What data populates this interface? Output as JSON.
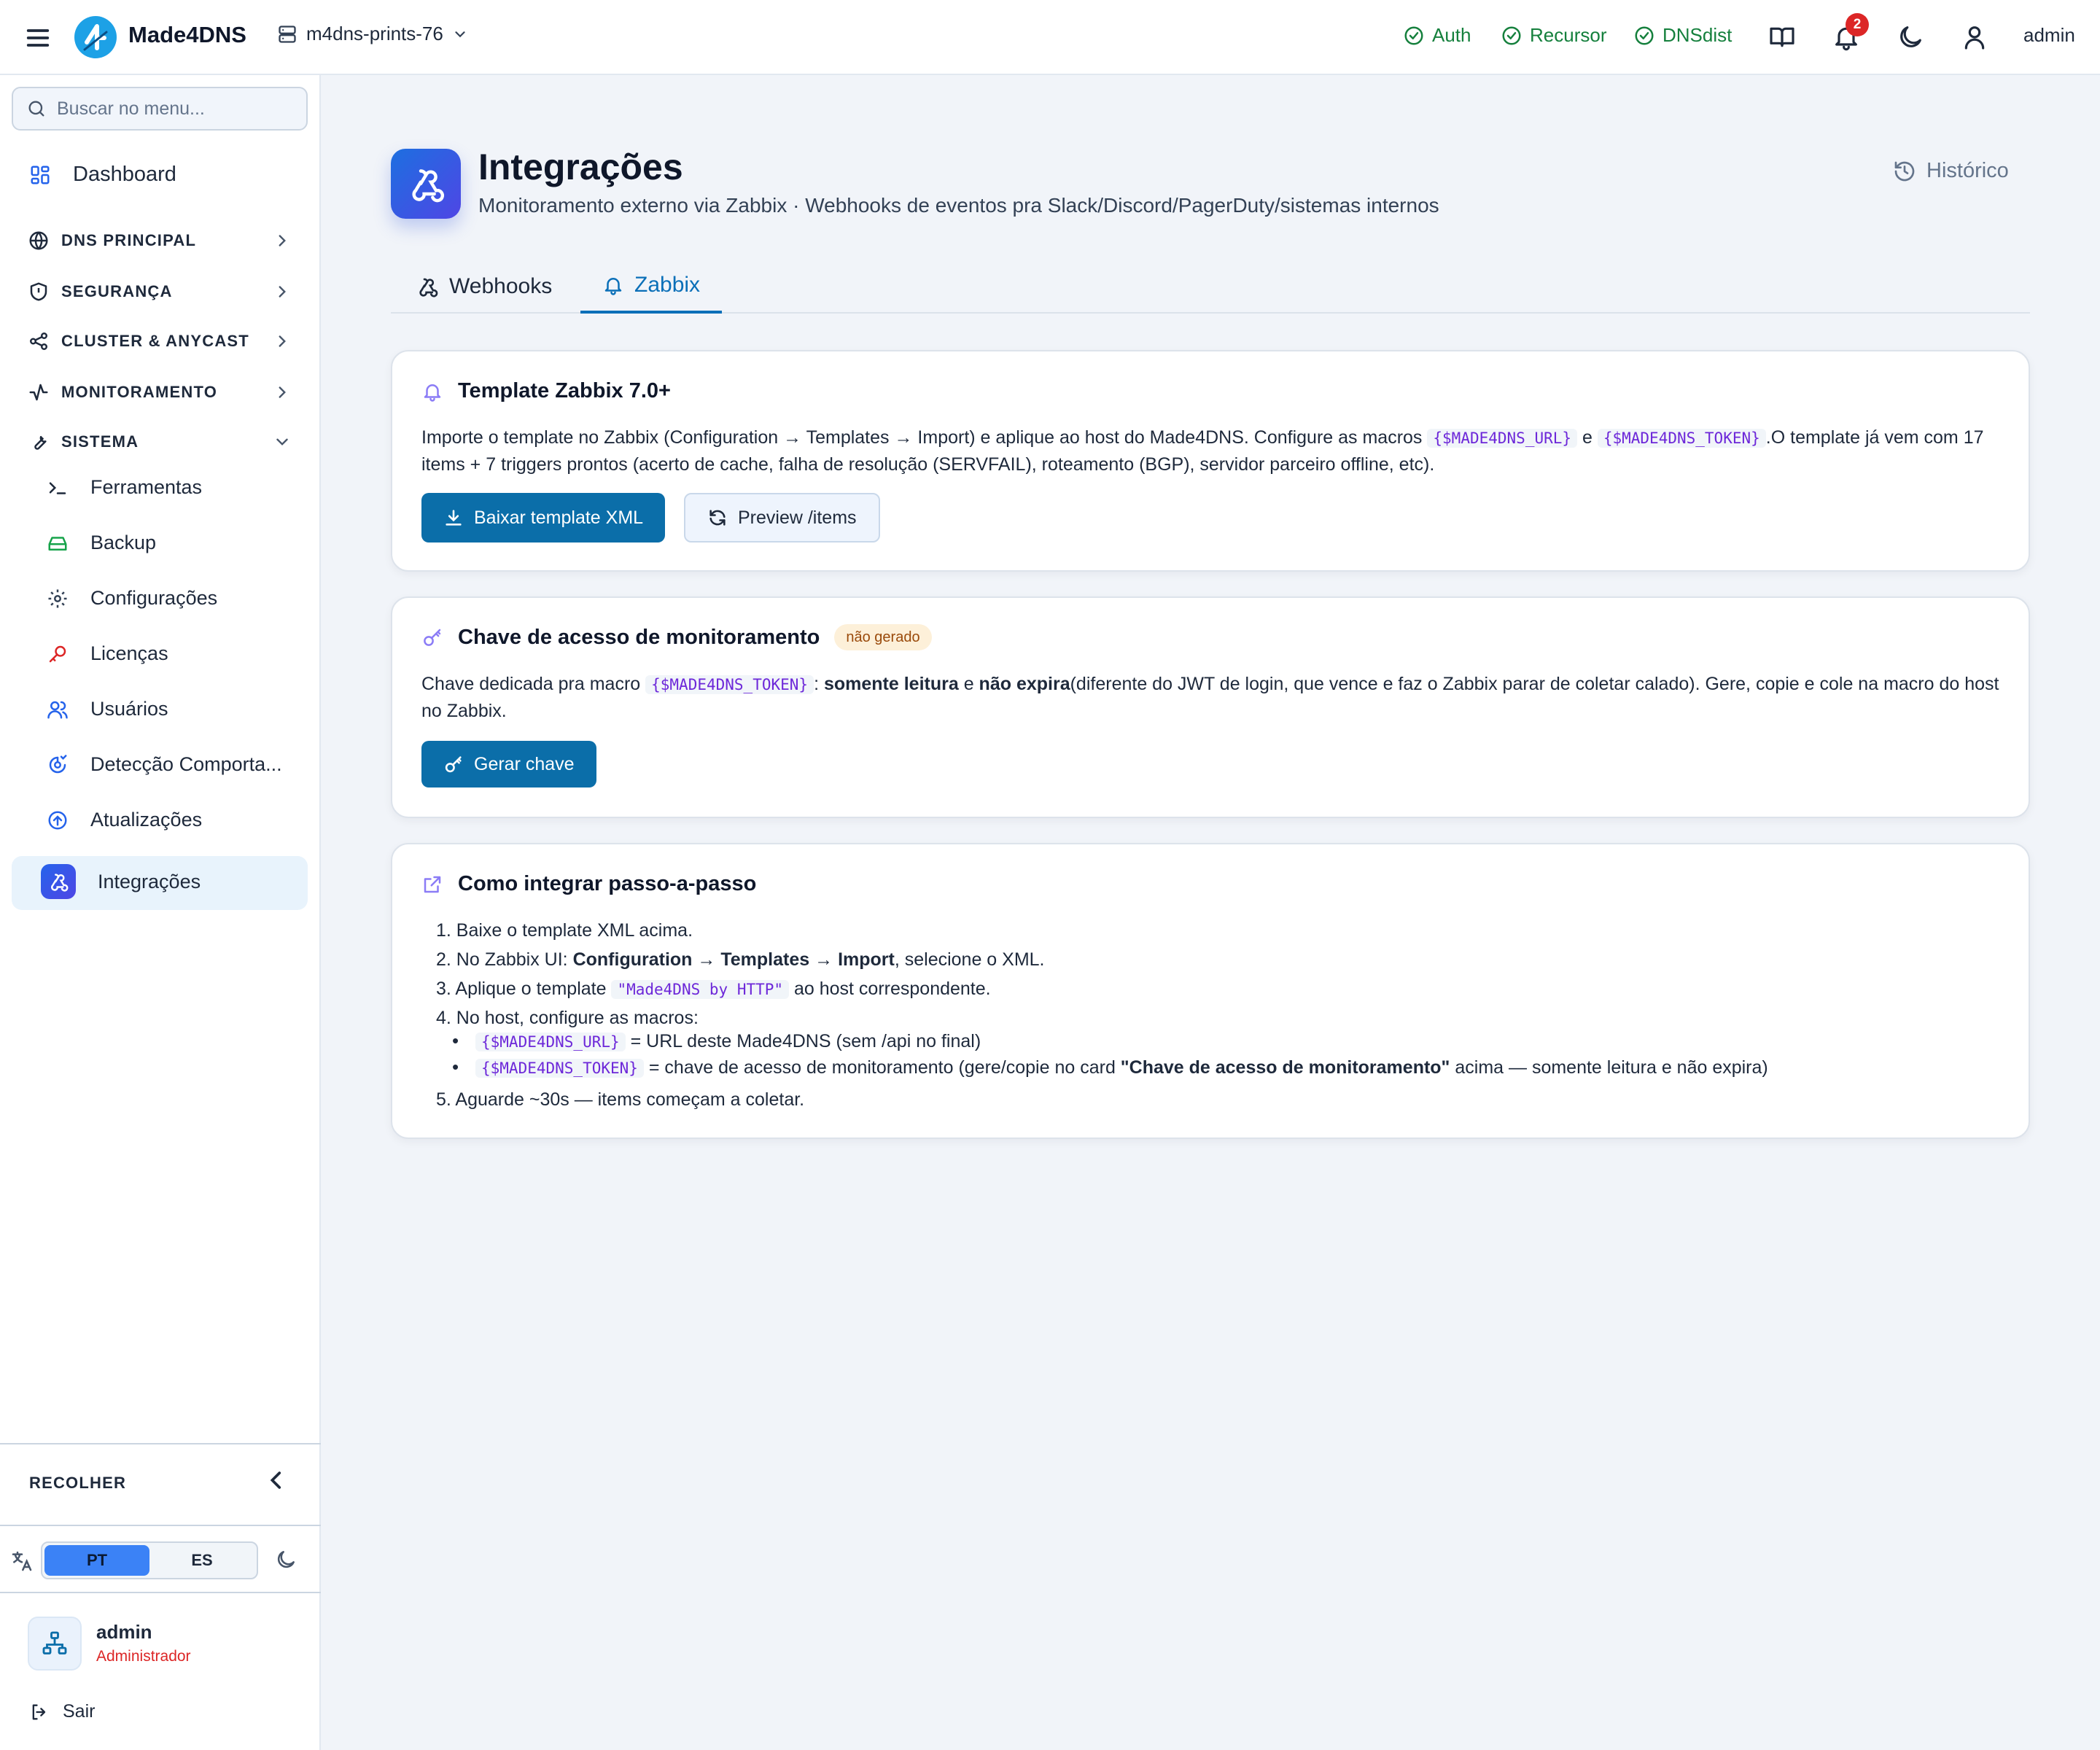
{
  "topbar": {
    "brand": "Made4DNS",
    "server": "m4dns-prints-76",
    "statuses": [
      {
        "label": "Auth",
        "state": "ok"
      },
      {
        "label": "Recursor",
        "state": "ok"
      },
      {
        "label": "DNSdist",
        "state": "ok"
      }
    ],
    "notifications": "2",
    "user": "admin",
    "colors": {
      "ok": "#15803d",
      "brand": "#0b6ea9",
      "badge": "#dc2626"
    }
  },
  "sidebar": {
    "search_placeholder": "Buscar no menu...",
    "dashboard": "Dashboard",
    "groups": [
      "DNS PRINCIPAL",
      "SEGURANÇA",
      "CLUSTER & ANYCAST",
      "MONITORAMENTO",
      "SISTEMA"
    ],
    "sistema_items": [
      "Ferramentas",
      "Backup",
      "Configurações",
      "Licenças",
      "Usuários",
      "Detecção Comporta...",
      "Atualizações",
      "Integrações"
    ],
    "active_item": "Integrações",
    "collapse": "RECOLHER",
    "lang": {
      "pt": "PT",
      "es": "ES",
      "selected": "PT"
    },
    "user": {
      "name": "admin",
      "role": "Administrador"
    },
    "logout": "Sair"
  },
  "page": {
    "title": "Integrações",
    "subtitle": "Monitoramento externo via Zabbix · Webhooks de eventos pra Slack/Discord/PagerDuty/sistemas internos",
    "history": "Histórico",
    "tabs": [
      {
        "label": "Webhooks"
      },
      {
        "label": "Zabbix"
      }
    ],
    "active_tab": "Zabbix"
  },
  "template_card": {
    "title": "Template Zabbix 7.0+",
    "text_a": "Importe o template no Zabbix (Configuration → Templates → Import) e aplique ao host do Made4DNS. Configure as macros ",
    "macro_url": "{$MADE4DNS_URL}",
    "text_e": " e ",
    "macro_token": "{$MADE4DNS_TOKEN}",
    "text_b": ".O template já vem com 17 items + 7 triggers prontos (acerto de cache, falha de resolução (SERVFAIL), roteamento (BGP), servidor parceiro offline, etc).",
    "btn_download": "Baixar template XML",
    "btn_preview": "Preview /items"
  },
  "key_card": {
    "title": "Chave de acesso de monitoramento",
    "badge": "não gerado",
    "text_a": "Chave dedicada pra macro ",
    "macro_token": "{$MADE4DNS_TOKEN}",
    "text_colon": ": ",
    "bold_read": "somente leitura",
    "text_e": " e ",
    "bold_expire": "não expira",
    "text_b": "(diferente do JWT de login, que vence e faz o Zabbix parar de coletar calado). Gere, copie e cole na macro do host no Zabbix.",
    "btn_generate": "Gerar chave"
  },
  "steps_card": {
    "title": "Como integrar passo-a-passo",
    "s1": "1. Baixe o template XML acima.",
    "s2_a": "2. No Zabbix UI: ",
    "s2_b1": "Configuration",
    "s2_arrow1": " → ",
    "s2_b2": "Templates",
    "s2_arrow2": " → ",
    "s2_b3": "Import",
    "s2_c": ", selecione o XML.",
    "s3_a": "3. Aplique o template ",
    "s3_code": "\"Made4DNS by HTTP\"",
    "s3_b": " ao host correspondente.",
    "s4": "4. No host, configure as macros:",
    "b1_code": "{$MADE4DNS_URL}",
    "b1_text": " = URL deste Made4DNS (sem /api no final)",
    "b2_code": "{$MADE4DNS_TOKEN}",
    "b2_text": " = chave de acesso de monitoramento (gere/copie no card ",
    "b2_bold": "\"Chave de acesso de monitoramento\"",
    "b2_tail": " acima — somente leitura e não expira)",
    "s5": "5. Aguarde ~30s — items começam a coletar."
  }
}
